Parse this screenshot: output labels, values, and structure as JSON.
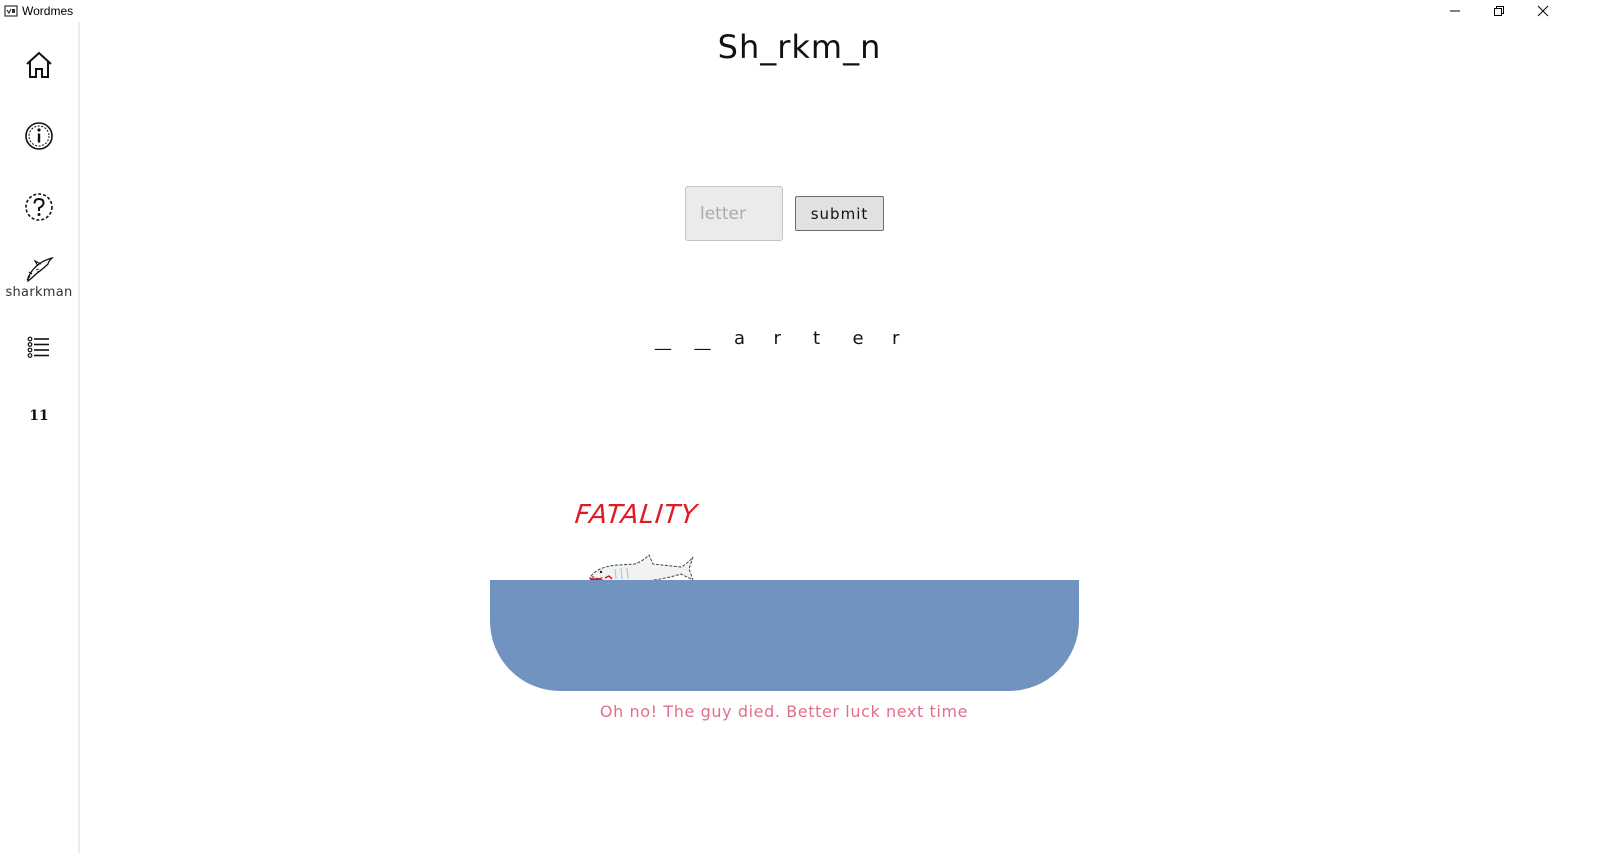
{
  "window": {
    "title": "Wordmes",
    "controls": [
      "minimize-icon",
      "restore-icon",
      "close-icon"
    ]
  },
  "sidebar": {
    "items": [
      {
        "name": "home",
        "icon": "home-icon",
        "label": ""
      },
      {
        "name": "info",
        "icon": "info-icon",
        "label": ""
      },
      {
        "name": "help",
        "icon": "question-icon",
        "label": ""
      },
      {
        "name": "sharkman",
        "icon": "shark-icon",
        "label": "sharkman"
      },
      {
        "name": "list",
        "icon": "list-icon",
        "label": ""
      },
      {
        "name": "eleven",
        "icon": "",
        "label": "11"
      }
    ]
  },
  "main": {
    "title": "Sh_rkm_n",
    "input_placeholder": "letter",
    "input_value": "",
    "submit_label": "submit",
    "word_slots": [
      "__",
      "__",
      "a",
      "r",
      "t",
      "e",
      "r"
    ],
    "fatality_text": "FATALITY",
    "message": "Oh no! The guy died. Better luck next time"
  },
  "colors": {
    "water": "#7094bf",
    "fatality": "#e01b24",
    "message": "#e26f8a",
    "blood": "#d8121b"
  }
}
